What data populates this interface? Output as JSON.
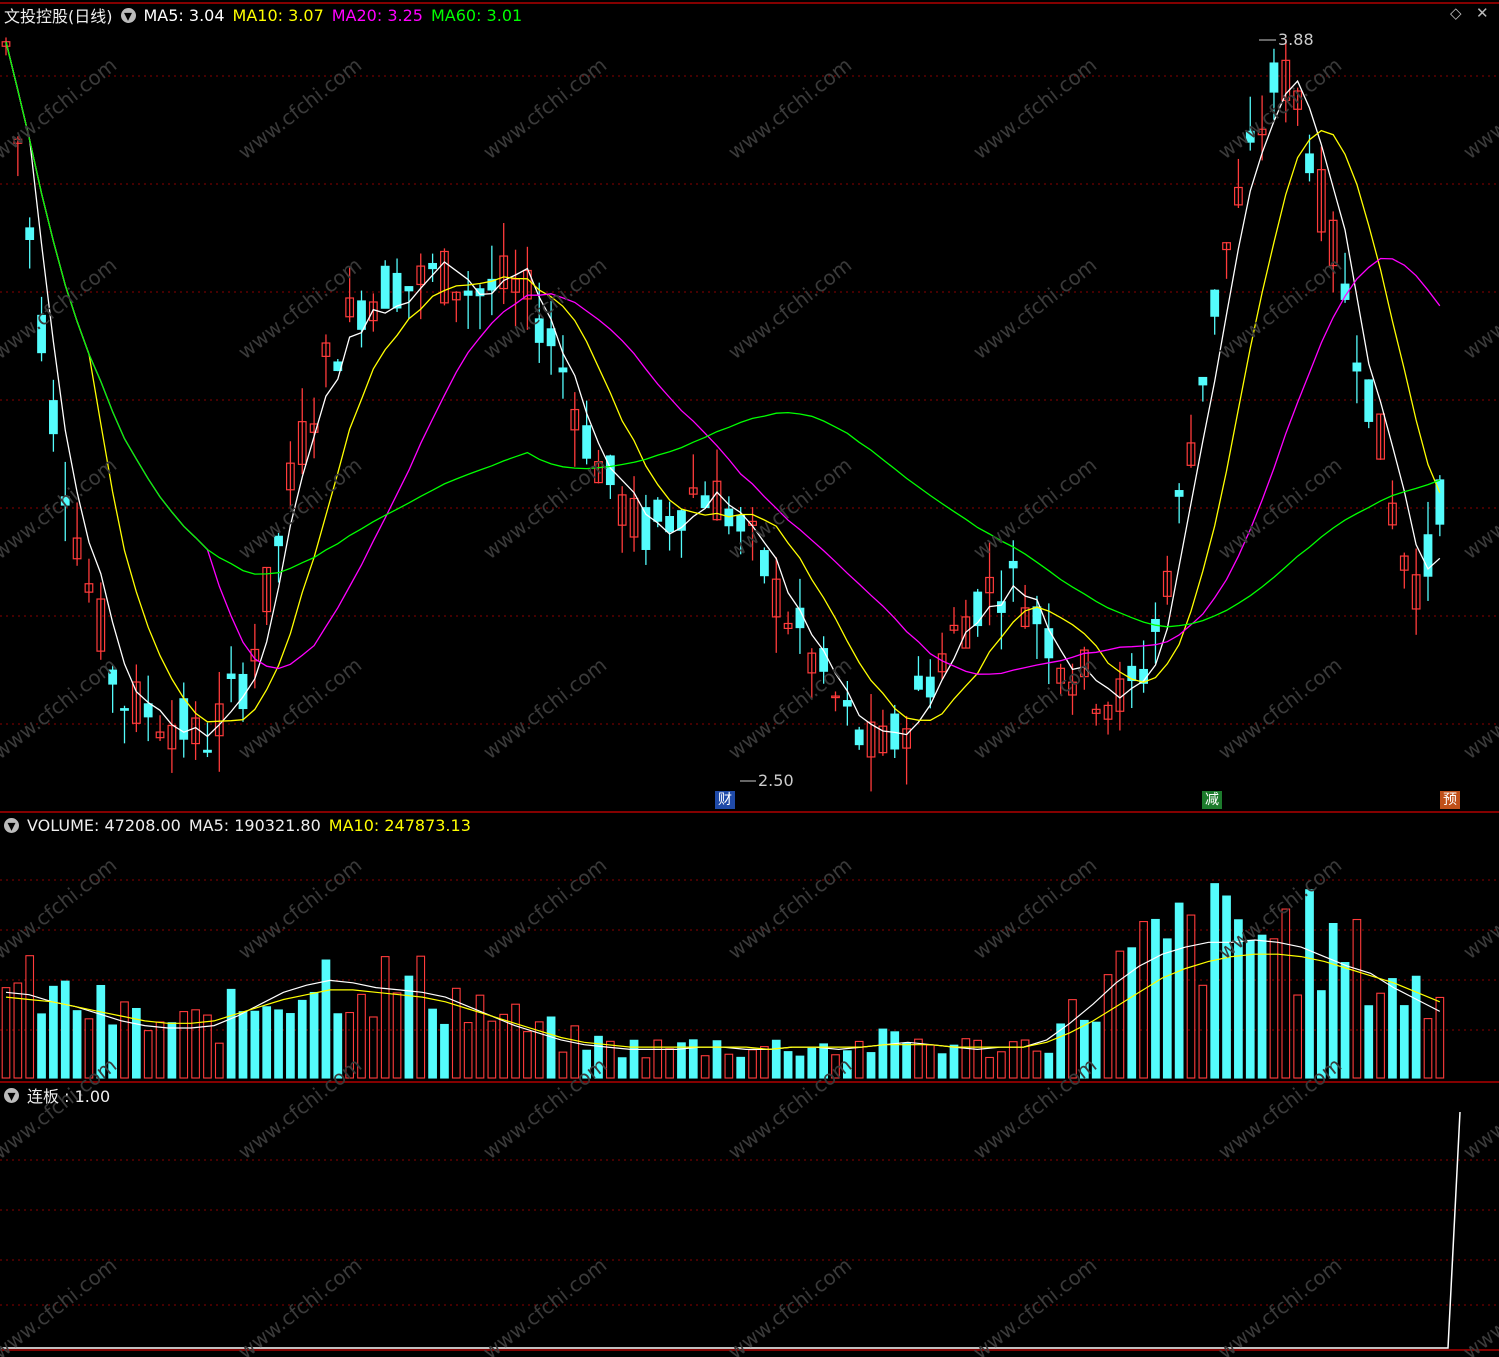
{
  "stock": {
    "title": "文投控股(日线)",
    "ma5_label": "MA5: 3.04",
    "ma10_label": "MA10: 3.07",
    "ma20_label": "MA20: 3.25",
    "ma60_label": "MA60: 3.01"
  },
  "volume": {
    "label": "VOLUME: 47208.00",
    "ma5_label": "MA5: 190321.80",
    "ma10_label": "MA10: 247873.13"
  },
  "lianban": {
    "label": "连板 : 1.00"
  },
  "annotations": {
    "high": "3.88",
    "low": "2.50"
  },
  "markers": {
    "cai": "财",
    "jian": "减",
    "yu": "预"
  },
  "icons": [
    "diamond-icon",
    "close-icon",
    "dropdown-circle-icon"
  ],
  "watermark": "www.cfchi.com",
  "colors": {
    "up": "#ff3b3b",
    "down": "#54fcfc",
    "ma5": "#ffffff",
    "ma10": "#ffff00",
    "ma20": "#ff00ff",
    "ma60": "#00ff00",
    "grid": "#8a0000",
    "border": "#b00000"
  },
  "chart_data": {
    "type": "candlestick",
    "price_range": [
      2.5,
      3.88
    ],
    "prices": [
      3.86,
      3.62,
      3.38,
      3.16,
      3.0,
      2.86,
      2.75,
      2.64,
      2.62,
      2.61,
      2.6,
      2.58,
      2.55,
      2.58,
      2.63,
      2.69,
      2.8,
      2.94,
      3.08,
      3.18,
      3.27,
      3.33,
      3.38,
      3.4,
      3.42,
      3.41,
      3.42,
      3.43,
      3.42,
      3.4,
      3.4,
      3.41,
      3.39,
      3.36,
      3.3,
      3.22,
      3.13,
      3.06,
      3.01,
      2.96,
      2.95,
      2.97,
      3.01,
      3.03,
      3.02,
      2.98,
      2.93,
      2.88,
      2.82,
      2.77,
      2.71,
      2.66,
      2.6,
      2.56,
      2.53,
      2.55,
      2.6,
      2.66,
      2.71,
      2.76,
      2.81,
      2.84,
      2.86,
      2.84,
      2.79,
      2.74,
      2.7,
      2.67,
      2.65,
      2.63,
      2.65,
      2.72,
      2.86,
      3.02,
      3.2,
      3.37,
      3.52,
      3.62,
      3.72,
      3.81,
      3.78,
      3.66,
      3.52,
      3.41,
      3.29,
      3.16,
      3.0,
      2.88,
      2.84,
      3.02
    ],
    "volume_ma5": [
      0.36,
      0.35,
      0.32,
      0.3,
      0.27,
      0.24,
      0.22,
      0.21,
      0.21,
      0.22,
      0.26,
      0.31,
      0.36,
      0.39,
      0.41,
      0.4,
      0.38,
      0.37,
      0.36,
      0.34,
      0.3,
      0.26,
      0.22,
      0.19,
      0.16,
      0.14,
      0.13,
      0.12,
      0.12,
      0.12,
      0.13,
      0.13,
      0.12,
      0.12,
      0.13,
      0.13,
      0.12,
      0.13,
      0.14,
      0.15,
      0.14,
      0.13,
      0.12,
      0.13,
      0.13,
      0.16,
      0.23,
      0.31,
      0.4,
      0.47,
      0.52,
      0.55,
      0.57,
      0.57,
      0.58,
      0.57,
      0.55,
      0.51,
      0.47,
      0.44,
      0.38,
      0.33,
      0.28
    ],
    "volume_ma10": [
      0.34,
      0.33,
      0.32,
      0.3,
      0.28,
      0.26,
      0.24,
      0.23,
      0.23,
      0.24,
      0.27,
      0.3,
      0.33,
      0.35,
      0.37,
      0.37,
      0.36,
      0.35,
      0.34,
      0.32,
      0.29,
      0.26,
      0.23,
      0.2,
      0.17,
      0.15,
      0.14,
      0.13,
      0.13,
      0.13,
      0.13,
      0.13,
      0.13,
      0.12,
      0.13,
      0.13,
      0.13,
      0.13,
      0.14,
      0.14,
      0.14,
      0.13,
      0.13,
      0.13,
      0.13,
      0.15,
      0.19,
      0.24,
      0.3,
      0.36,
      0.42,
      0.46,
      0.49,
      0.51,
      0.52,
      0.52,
      0.51,
      0.49,
      0.46,
      0.43,
      0.4,
      0.36,
      0.32
    ],
    "lianban_value": 1.0
  }
}
